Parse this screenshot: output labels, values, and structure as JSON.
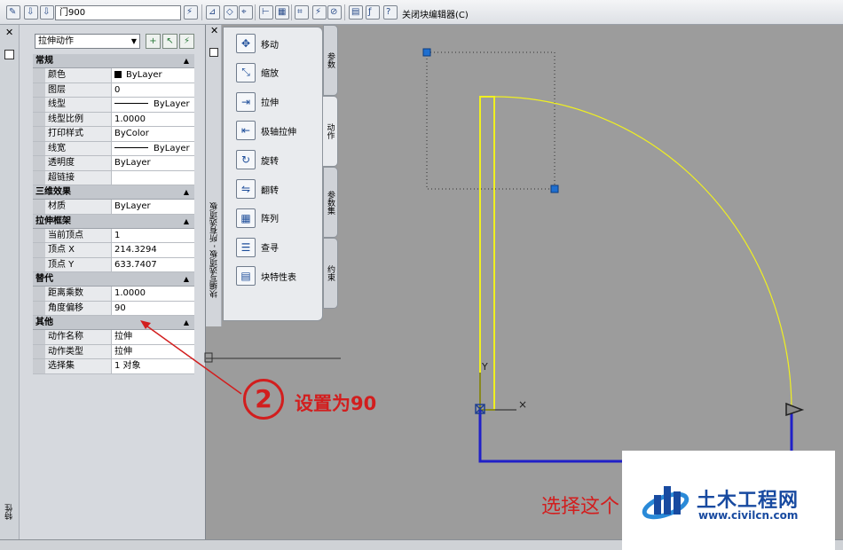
{
  "toolbar": {
    "block_name": "门900",
    "close_editor_label": "关闭块编辑器(C)"
  },
  "properties_palette": {
    "side_label": "特性",
    "selector_value": "拉伸动作",
    "categories": [
      {
        "title": "常规",
        "rows": [
          {
            "name": "颜色",
            "value": "ByLayer"
          },
          {
            "name": "图层",
            "value": "0"
          },
          {
            "name": "线型",
            "value": "ByLayer"
          },
          {
            "name": "线型比例",
            "value": "1.0000"
          },
          {
            "name": "打印样式",
            "value": "ByColor"
          },
          {
            "name": "线宽",
            "value": "ByLayer"
          },
          {
            "name": "透明度",
            "value": "ByLayer"
          },
          {
            "name": "超链接",
            "value": ""
          }
        ]
      },
      {
        "title": "三维效果",
        "rows": [
          {
            "name": "材质",
            "value": "ByLayer"
          }
        ]
      },
      {
        "title": "拉伸框架",
        "rows": [
          {
            "name": "当前顶点",
            "value": "1"
          },
          {
            "name": "顶点 X",
            "value": "214.3294"
          },
          {
            "name": "顶点 Y",
            "value": "633.7407"
          }
        ]
      },
      {
        "title": "替代",
        "rows": [
          {
            "name": "距离乘数",
            "value": "1.0000"
          },
          {
            "name": "角度偏移",
            "value": "90"
          }
        ]
      },
      {
        "title": "其他",
        "rows": [
          {
            "name": "动作名称",
            "value": "拉伸"
          },
          {
            "name": "动作类型",
            "value": "拉伸"
          },
          {
            "name": "选择集",
            "value": "1 对象"
          }
        ]
      }
    ]
  },
  "authoring_palette": {
    "title": "块编写选项板 - 所有选项板",
    "tools": [
      "移动",
      "缩放",
      "拉伸",
      "极轴拉伸",
      "旋转",
      "翻转",
      "阵列",
      "查寻",
      "块特性表"
    ],
    "tool_icons": [
      "move-icon",
      "scale-icon",
      "stretch-icon",
      "polar-stretch-icon",
      "rotate-icon",
      "flip-icon",
      "array-icon",
      "lookup-icon",
      "block-table-icon"
    ],
    "tabs": [
      "参数",
      "动作",
      "参数集",
      "约束"
    ],
    "active_tab": "动作"
  },
  "drawing": {
    "colors": {
      "door": "#f0f020",
      "wall": "#2020c8",
      "frame": "#303030",
      "grip": "#1f6fd0"
    }
  },
  "annotation": {
    "step_number": "2",
    "text": "设置为90",
    "select_note": "选择这个"
  },
  "watermark": {
    "title": "土木工程网",
    "url": "www.civilcn.com"
  }
}
